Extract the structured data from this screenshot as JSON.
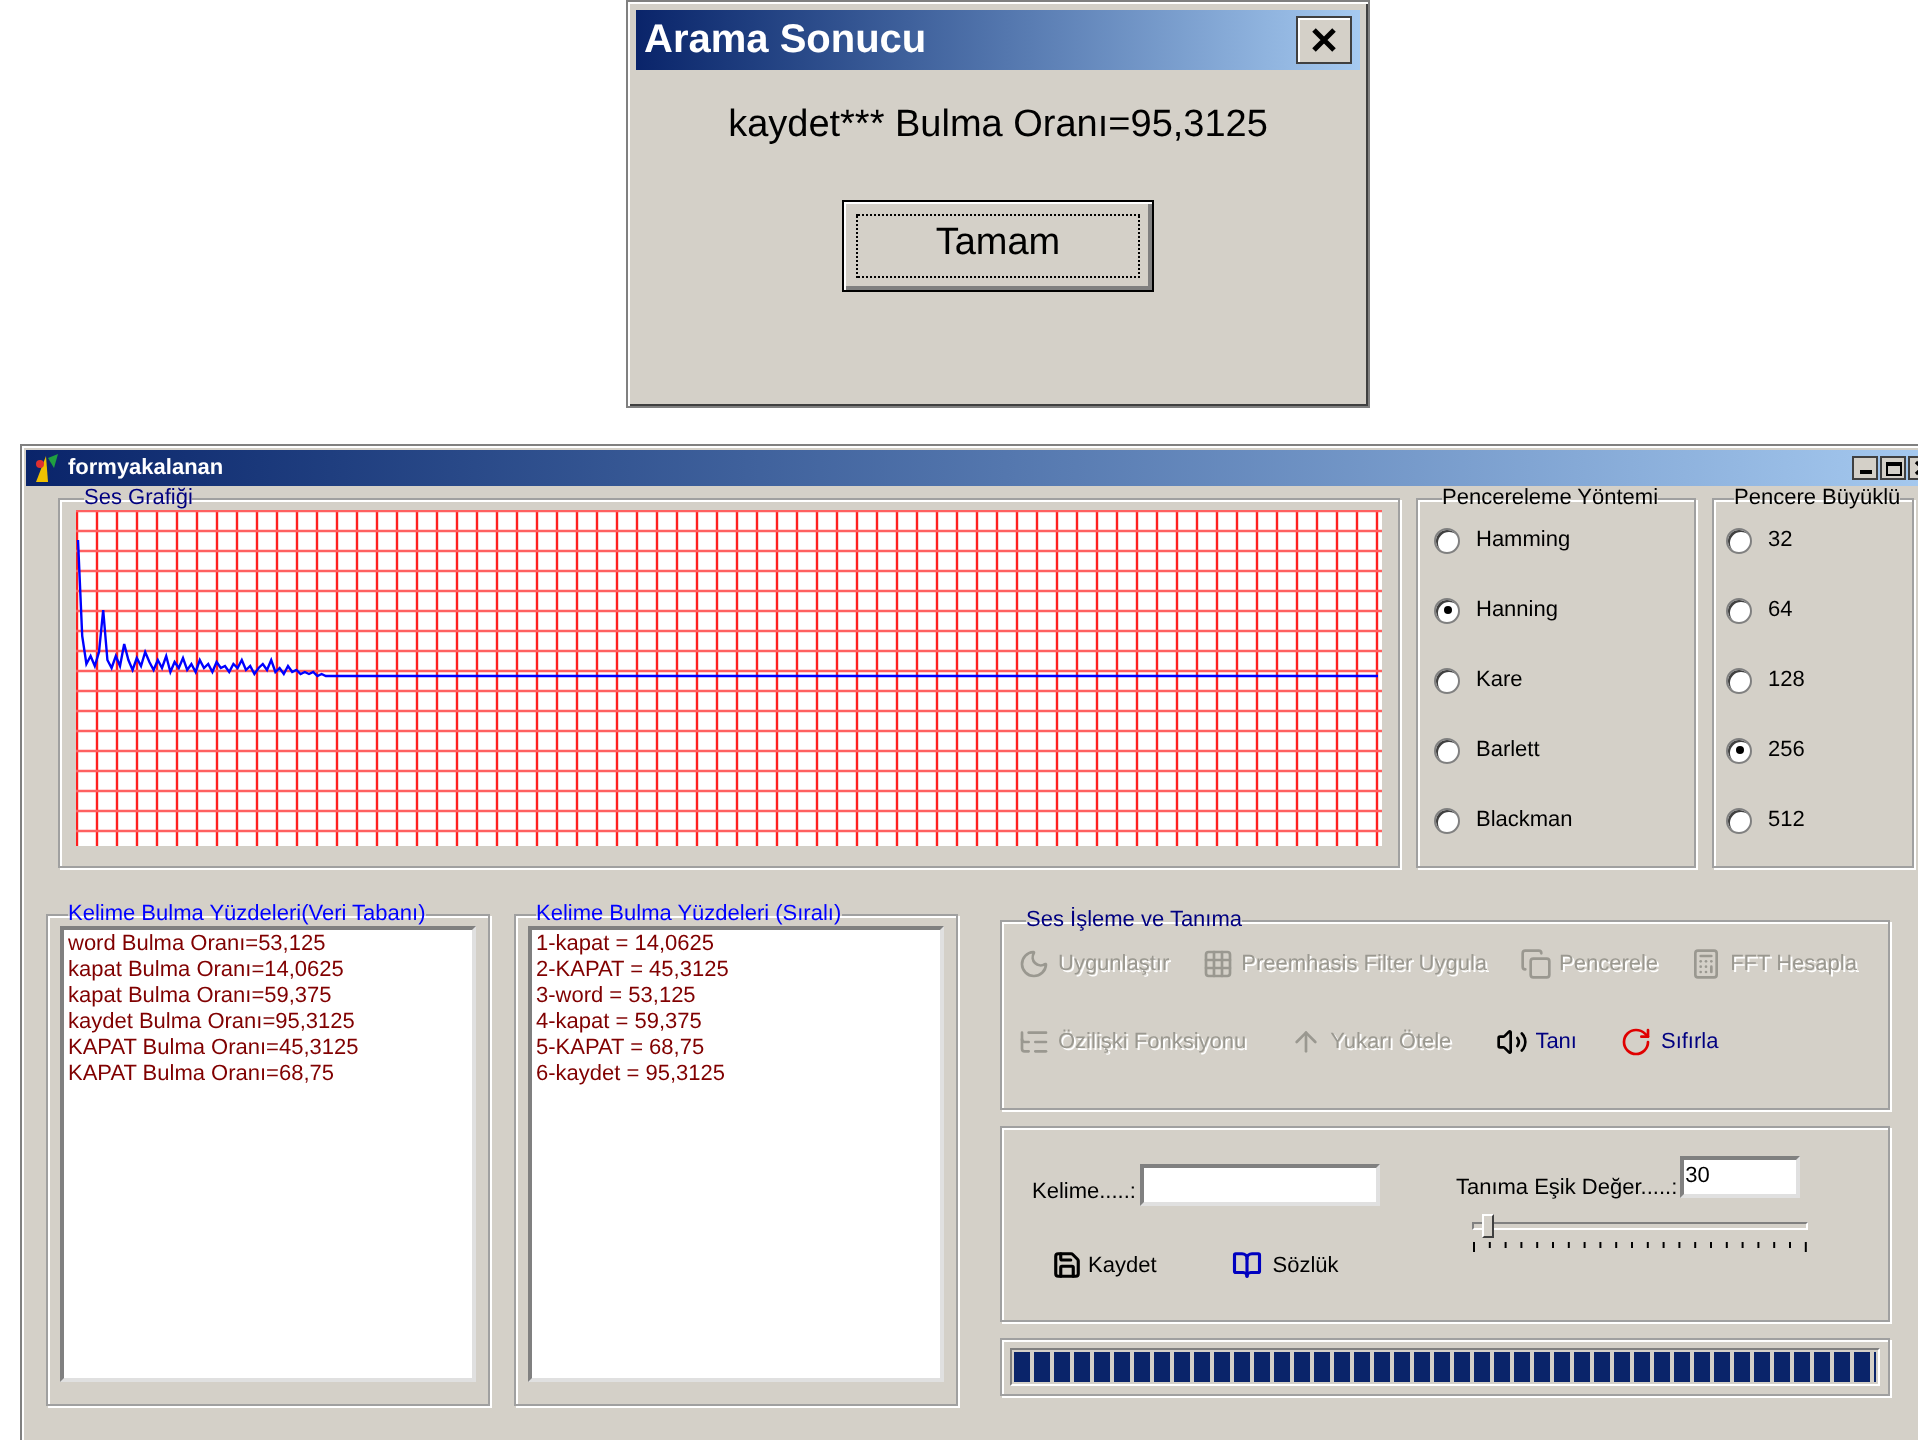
{
  "dialog": {
    "title": "Arama Sonucu",
    "message": "kaydet*** Bulma Oranı=95,3125",
    "button": "Tamam"
  },
  "window": {
    "title": "formyakalanan"
  },
  "graph": {
    "title": "Ses Grafiği"
  },
  "windowing_method": {
    "title": "Pencereleme Yöntemi",
    "options": [
      {
        "label": "Hamming",
        "selected": false
      },
      {
        "label": "Hanning",
        "selected": true
      },
      {
        "label": "Kare",
        "selected": false
      },
      {
        "label": "Barlett",
        "selected": false
      },
      {
        "label": "Blackman",
        "selected": false
      }
    ]
  },
  "window_size": {
    "title": "Pencere Büyüklü",
    "options": [
      {
        "label": "32",
        "selected": false
      },
      {
        "label": "64",
        "selected": false
      },
      {
        "label": "128",
        "selected": false
      },
      {
        "label": "256",
        "selected": true
      },
      {
        "label": "512",
        "selected": false
      }
    ]
  },
  "db_results": {
    "title": "Kelime Bulma Yüzdeleri(Veri Tabanı)",
    "items": [
      "word Bulma Oranı=53,125",
      "kapat Bulma Oranı=14,0625",
      "kapat Bulma Oranı=59,375",
      "kaydet Bulma Oranı=95,3125",
      "KAPAT Bulma Oranı=45,3125",
      "KAPAT Bulma Oranı=68,75"
    ]
  },
  "sorted_results": {
    "title": "Kelime Bulma Yüzdeleri (Sıralı)",
    "items": [
      "1-kapat = 14,0625",
      "2-KAPAT = 45,3125",
      "3-word = 53,125",
      "4-kapat = 59,375",
      "5-KAPAT = 68,75",
      "6-kaydet = 95,3125"
    ]
  },
  "processing": {
    "title": "Ses İşleme ve Tanıma",
    "buttons": [
      {
        "label": "Uygunlaştır",
        "disabled": true
      },
      {
        "label": "Preemhasis Filter Uygula",
        "disabled": true
      },
      {
        "label": "Pencerele",
        "disabled": true
      },
      {
        "label": "FFT Hesapla",
        "disabled": true
      },
      {
        "label": "Özilişki Fonksiyonu",
        "disabled": true
      },
      {
        "label": "Yukarı Ötele",
        "disabled": true
      },
      {
        "label": "Tanı",
        "disabled": false
      },
      {
        "label": "Sıfırla",
        "disabled": false
      }
    ]
  },
  "word_field": {
    "label": "Kelime.....:"
  },
  "threshold": {
    "label": "Tanıma Eşik Değer.....:",
    "value": "30",
    "level": 0.05
  },
  "actions": [
    "Kaydet",
    "Sözlük"
  ],
  "progress": {
    "level": 1
  }
}
